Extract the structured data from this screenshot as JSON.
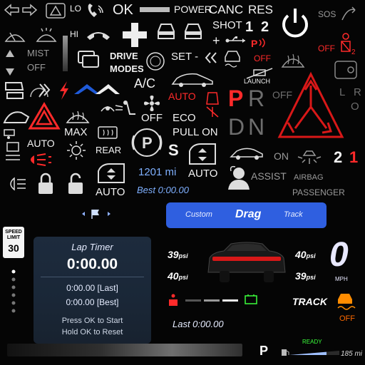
{
  "labels": {
    "lo": "LO",
    "ok": "OK",
    "power": "POWER",
    "canc": "CANC",
    "res": "RES",
    "sos": "SOS",
    "hi": "HI",
    "shot": "SHOT",
    "one": "1",
    "two": "2",
    "off_sm": "OFF",
    "mist": "MIST",
    "off_mist": "OFF",
    "drive_modes_1": "DRIVE",
    "drive_modes_2": "MODES",
    "set": "SET -",
    "off_red_p": "OFF",
    "launch": "LAUNCH",
    "ac": "A/C",
    "auto_red": "AUTO",
    "p_big": "P",
    "r_big": "R",
    "off_gray": "OFF",
    "l_letter": "L",
    "r_letter": "R",
    "o_letter": "O",
    "off_fan": "OFF",
    "eco": "ECO",
    "pull_on": "PULL ON",
    "d_big": "D",
    "n_big": "N",
    "max": "MAX",
    "auto_w": "AUTO",
    "rear": "REAR",
    "s_big": "S",
    "auto_w2": "AUTO",
    "on": "ON",
    "gear_2": "2",
    "gear_1": "1",
    "miles": "1201 mi",
    "assist": "ASSIST",
    "airbag": "AIRBAG",
    "passenger": "PASSENGER",
    "auto_w3": "AUTO",
    "best_top": "Best 0:00.00"
  },
  "modes": {
    "custom": "Custom",
    "drag": "Drag",
    "track": "Track"
  },
  "speed_limit": {
    "line1": "SPEED",
    "line2": "LIMIT",
    "value": "30"
  },
  "lap": {
    "title": "Lap Timer",
    "time": "0:00.00",
    "last": "0:00.00 [Last]",
    "best": "0:00.00 [Best]",
    "hint1": "Press OK to Start",
    "hint2": "Hold OK to Reset"
  },
  "tires": {
    "fl": "39",
    "fr": "40",
    "rl": "40",
    "rr": "39",
    "unit": "psi"
  },
  "speed": {
    "value": "0",
    "unit": "MPH"
  },
  "track_label": "TRACK",
  "tc_off": "OFF",
  "last_lap": "Last 0:00.00",
  "gear_p": "P",
  "ready": "READY",
  "range": "185 mi",
  "colors": {
    "accent_red": "#ff2a2a",
    "mode_blue": "#2f5fe0",
    "brand_blue": "#1f5ad8"
  }
}
